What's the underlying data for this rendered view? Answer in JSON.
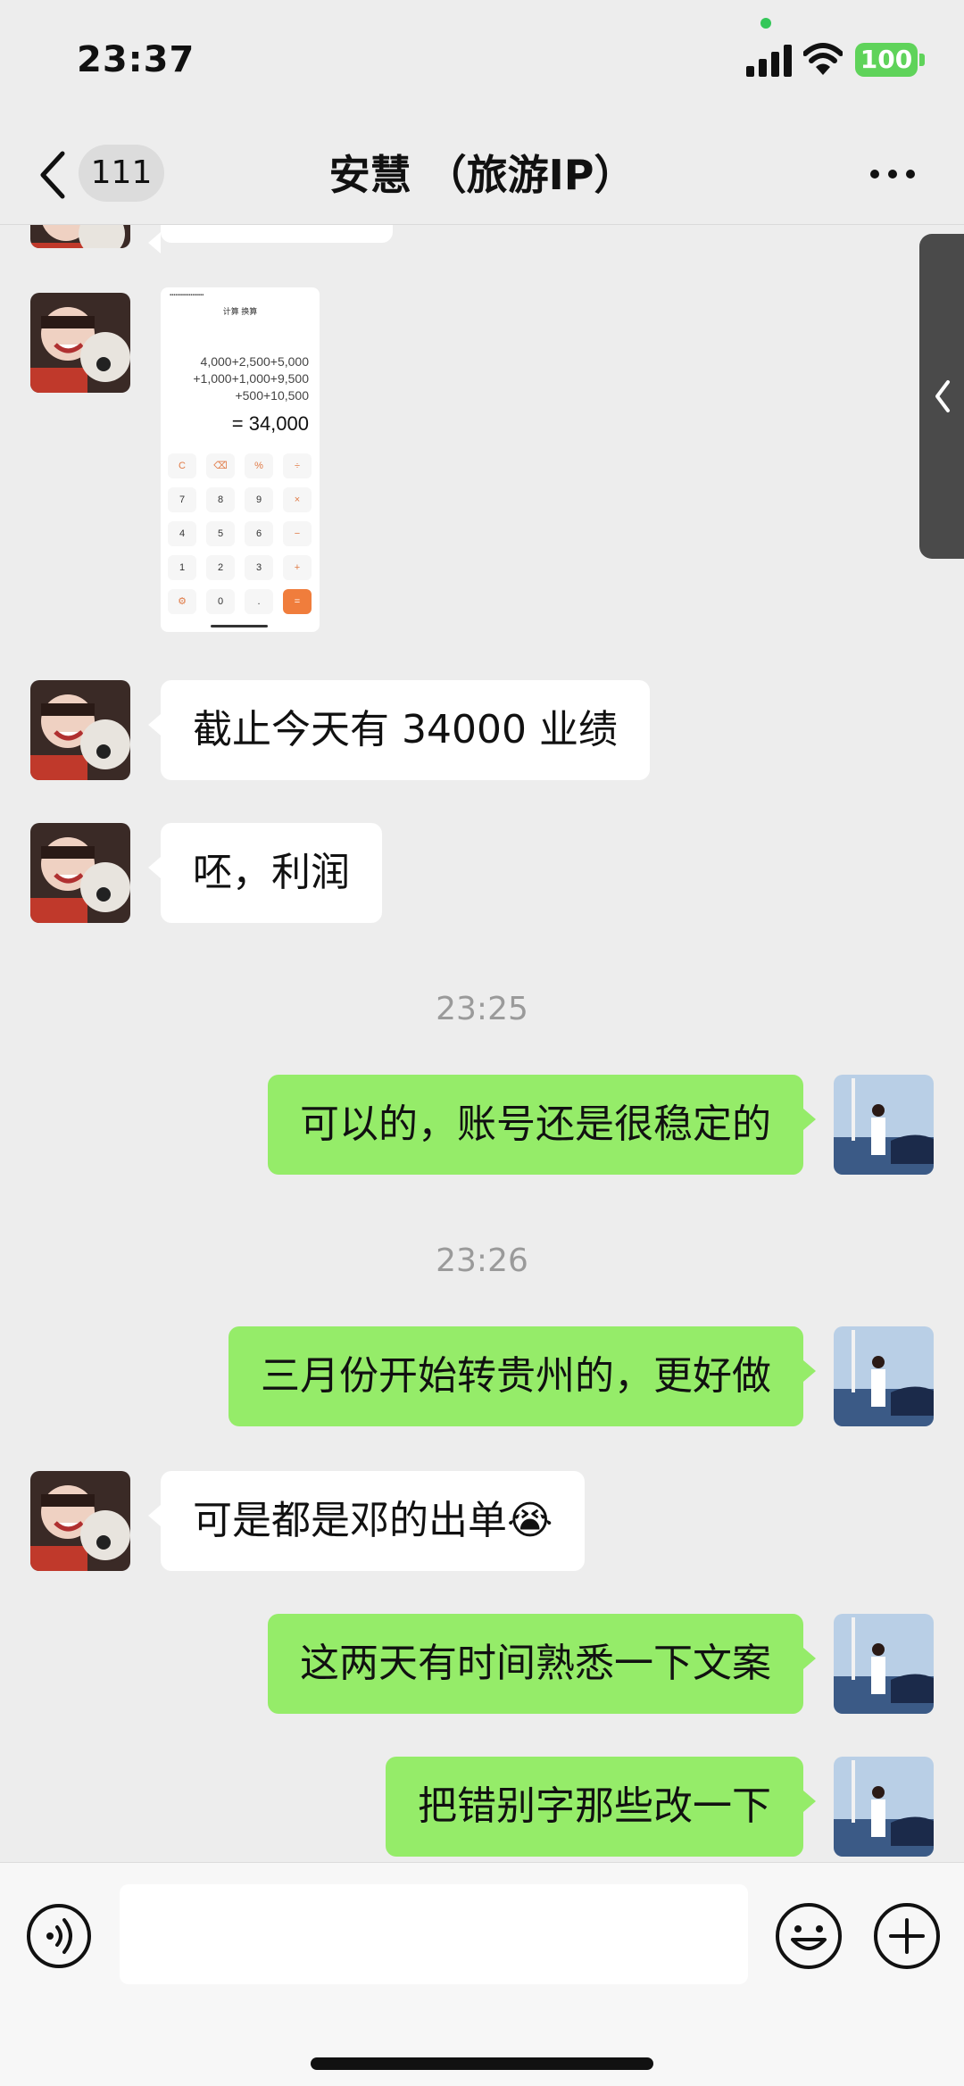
{
  "status_bar": {
    "time": "23:37",
    "battery": "100",
    "icons": [
      "signal-icon",
      "wifi-icon",
      "battery-icon"
    ]
  },
  "nav": {
    "unread_count": "111",
    "title": "安慧 （旅游IP）",
    "icons": [
      "back-icon",
      "more-icon"
    ]
  },
  "calc_screenshot": {
    "tabs": "计算   换算",
    "expression_line1": "4,000+2,500+5,000",
    "expression_line2": "+1,000+1,000+9,500",
    "expression_line3": "+500+10,500",
    "result": "= 34,000",
    "keys": [
      "C",
      "⌫",
      "%",
      "÷",
      "7",
      "8",
      "9",
      "×",
      "4",
      "5",
      "6",
      "−",
      "1",
      "2",
      "3",
      "+",
      "⚙",
      "0",
      ".",
      "="
    ]
  },
  "messages": [
    {
      "side": "in",
      "text": "截止今天有 34000 业绩"
    },
    {
      "side": "in",
      "text": "呸，利润"
    },
    {
      "side": "out",
      "text": "可以的，账号还是很稳定的"
    },
    {
      "side": "out",
      "text": "三月份开始转贵州的，更好做"
    },
    {
      "side": "in",
      "text": "可是都是邓的出单😭"
    },
    {
      "side": "out",
      "text": "这两天有时间熟悉一下文案"
    },
    {
      "side": "out",
      "text": "把错别字那些改一下"
    }
  ],
  "timestamps": [
    "23:25",
    "23:26"
  ],
  "input_bar": {
    "placeholder": "",
    "icons": [
      "voice-icon",
      "emoji-icon",
      "plus-icon"
    ]
  },
  "colors": {
    "background": "#ededed",
    "bubble_in": "#ffffff",
    "bubble_out": "#95ec69",
    "battery": "#5fd35a",
    "accent_orange": "#f07d3c"
  }
}
